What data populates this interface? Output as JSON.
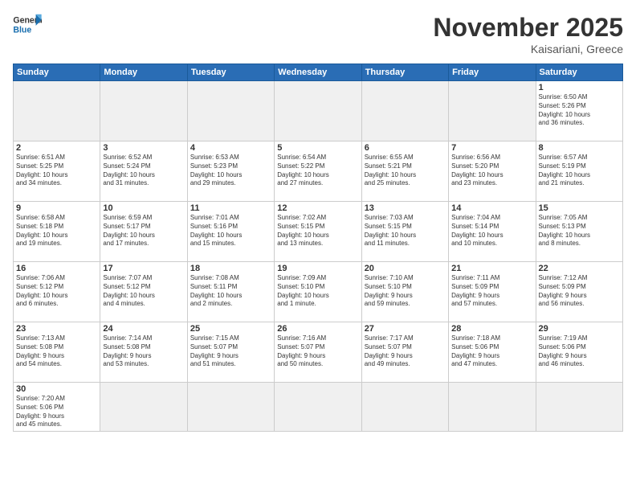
{
  "header": {
    "logo_general": "General",
    "logo_blue": "Blue",
    "month_title": "November 2025",
    "subtitle": "Kaisariani, Greece"
  },
  "weekdays": [
    "Sunday",
    "Monday",
    "Tuesday",
    "Wednesday",
    "Thursday",
    "Friday",
    "Saturday"
  ],
  "days": [
    {
      "day": "",
      "info": ""
    },
    {
      "day": "",
      "info": ""
    },
    {
      "day": "",
      "info": ""
    },
    {
      "day": "",
      "info": ""
    },
    {
      "day": "",
      "info": ""
    },
    {
      "day": "",
      "info": ""
    },
    {
      "day": "1",
      "info": "Sunrise: 6:50 AM\nSunset: 5:26 PM\nDaylight: 10 hours\nand 36 minutes."
    },
    {
      "day": "2",
      "info": "Sunrise: 6:51 AM\nSunset: 5:25 PM\nDaylight: 10 hours\nand 34 minutes."
    },
    {
      "day": "3",
      "info": "Sunrise: 6:52 AM\nSunset: 5:24 PM\nDaylight: 10 hours\nand 31 minutes."
    },
    {
      "day": "4",
      "info": "Sunrise: 6:53 AM\nSunset: 5:23 PM\nDaylight: 10 hours\nand 29 minutes."
    },
    {
      "day": "5",
      "info": "Sunrise: 6:54 AM\nSunset: 5:22 PM\nDaylight: 10 hours\nand 27 minutes."
    },
    {
      "day": "6",
      "info": "Sunrise: 6:55 AM\nSunset: 5:21 PM\nDaylight: 10 hours\nand 25 minutes."
    },
    {
      "day": "7",
      "info": "Sunrise: 6:56 AM\nSunset: 5:20 PM\nDaylight: 10 hours\nand 23 minutes."
    },
    {
      "day": "8",
      "info": "Sunrise: 6:57 AM\nSunset: 5:19 PM\nDaylight: 10 hours\nand 21 minutes."
    },
    {
      "day": "9",
      "info": "Sunrise: 6:58 AM\nSunset: 5:18 PM\nDaylight: 10 hours\nand 19 minutes."
    },
    {
      "day": "10",
      "info": "Sunrise: 6:59 AM\nSunset: 5:17 PM\nDaylight: 10 hours\nand 17 minutes."
    },
    {
      "day": "11",
      "info": "Sunrise: 7:01 AM\nSunset: 5:16 PM\nDaylight: 10 hours\nand 15 minutes."
    },
    {
      "day": "12",
      "info": "Sunrise: 7:02 AM\nSunset: 5:15 PM\nDaylight: 10 hours\nand 13 minutes."
    },
    {
      "day": "13",
      "info": "Sunrise: 7:03 AM\nSunset: 5:15 PM\nDaylight: 10 hours\nand 11 minutes."
    },
    {
      "day": "14",
      "info": "Sunrise: 7:04 AM\nSunset: 5:14 PM\nDaylight: 10 hours\nand 10 minutes."
    },
    {
      "day": "15",
      "info": "Sunrise: 7:05 AM\nSunset: 5:13 PM\nDaylight: 10 hours\nand 8 minutes."
    },
    {
      "day": "16",
      "info": "Sunrise: 7:06 AM\nSunset: 5:12 PM\nDaylight: 10 hours\nand 6 minutes."
    },
    {
      "day": "17",
      "info": "Sunrise: 7:07 AM\nSunset: 5:12 PM\nDaylight: 10 hours\nand 4 minutes."
    },
    {
      "day": "18",
      "info": "Sunrise: 7:08 AM\nSunset: 5:11 PM\nDaylight: 10 hours\nand 2 minutes."
    },
    {
      "day": "19",
      "info": "Sunrise: 7:09 AM\nSunset: 5:10 PM\nDaylight: 10 hours\nand 1 minute."
    },
    {
      "day": "20",
      "info": "Sunrise: 7:10 AM\nSunset: 5:10 PM\nDaylight: 9 hours\nand 59 minutes."
    },
    {
      "day": "21",
      "info": "Sunrise: 7:11 AM\nSunset: 5:09 PM\nDaylight: 9 hours\nand 57 minutes."
    },
    {
      "day": "22",
      "info": "Sunrise: 7:12 AM\nSunset: 5:09 PM\nDaylight: 9 hours\nand 56 minutes."
    },
    {
      "day": "23",
      "info": "Sunrise: 7:13 AM\nSunset: 5:08 PM\nDaylight: 9 hours\nand 54 minutes."
    },
    {
      "day": "24",
      "info": "Sunrise: 7:14 AM\nSunset: 5:08 PM\nDaylight: 9 hours\nand 53 minutes."
    },
    {
      "day": "25",
      "info": "Sunrise: 7:15 AM\nSunset: 5:07 PM\nDaylight: 9 hours\nand 51 minutes."
    },
    {
      "day": "26",
      "info": "Sunrise: 7:16 AM\nSunset: 5:07 PM\nDaylight: 9 hours\nand 50 minutes."
    },
    {
      "day": "27",
      "info": "Sunrise: 7:17 AM\nSunset: 5:07 PM\nDaylight: 9 hours\nand 49 minutes."
    },
    {
      "day": "28",
      "info": "Sunrise: 7:18 AM\nSunset: 5:06 PM\nDaylight: 9 hours\nand 47 minutes."
    },
    {
      "day": "29",
      "info": "Sunrise: 7:19 AM\nSunset: 5:06 PM\nDaylight: 9 hours\nand 46 minutes."
    },
    {
      "day": "30",
      "info": "Sunrise: 7:20 AM\nSunset: 5:06 PM\nDaylight: 9 hours\nand 45 minutes."
    },
    {
      "day": "",
      "info": ""
    },
    {
      "day": "",
      "info": ""
    },
    {
      "day": "",
      "info": ""
    },
    {
      "day": "",
      "info": ""
    },
    {
      "day": "",
      "info": ""
    },
    {
      "day": "",
      "info": ""
    }
  ]
}
